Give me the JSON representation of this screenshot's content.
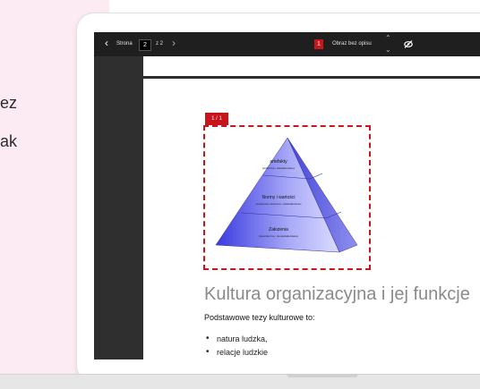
{
  "background_text": {
    "line1": "ez",
    "line2": "ak"
  },
  "toolbar": {
    "back_glyph": "‹",
    "page_label": "Strona",
    "page_value": "2",
    "page_of": "z 2",
    "next_glyph": "›",
    "alt_badge": "1",
    "alt_label": "Obraz bez opisu",
    "up_glyph": "⌃",
    "down_glyph": "⌄",
    "visibility_icon": "eye-off-icon"
  },
  "document": {
    "image_badge": "1 / 1",
    "pyramid": {
      "top_title": "artefakty",
      "top_sub": "(widoczne i uświadamiane)",
      "middle_title": "Normy i wartości",
      "middle_sub": "(częściowo widoczne i uświadamiane)",
      "bottom_title": "Założenia",
      "bottom_sub": "(niewidoczne i nieuświadamiane)"
    },
    "heading": "Kultura organizacyjna i jej funkcje",
    "intro": "Podstawowe tezy kulturowe to:",
    "bullets": [
      "natura ludzka,",
      "relacje ludzkie"
    ]
  },
  "colors": {
    "accent_red": "#c8151b",
    "toolbar_bg": "#1f1f1f",
    "pink_bg": "#fcebf2"
  }
}
